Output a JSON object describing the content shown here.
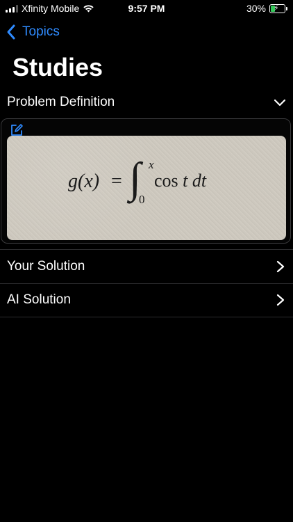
{
  "status_bar": {
    "carrier": "Xfinity Mobile",
    "time": "9:57 PM",
    "battery": "30%",
    "battery_level": 0.3,
    "icons": [
      "signal-icon",
      "wifi-icon",
      "battery-charging-icon"
    ]
  },
  "nav": {
    "back_label": "Topics",
    "title": "Studies"
  },
  "problem": {
    "label": "Problem Definition",
    "formula": {
      "lhs": "g(x)",
      "equals": "=",
      "integral": "∫",
      "upper_limit": "x",
      "lower_limit": "0",
      "integrand_fn": "cos",
      "integrand_var": "t",
      "differential": "dt"
    }
  },
  "rows": [
    {
      "label": "Your Solution"
    },
    {
      "label": "AI Solution"
    }
  ],
  "colors": {
    "accent": "#2f8bff",
    "background": "#000000",
    "separator": "#2c2c2e",
    "battery_fill": "#34c759"
  }
}
